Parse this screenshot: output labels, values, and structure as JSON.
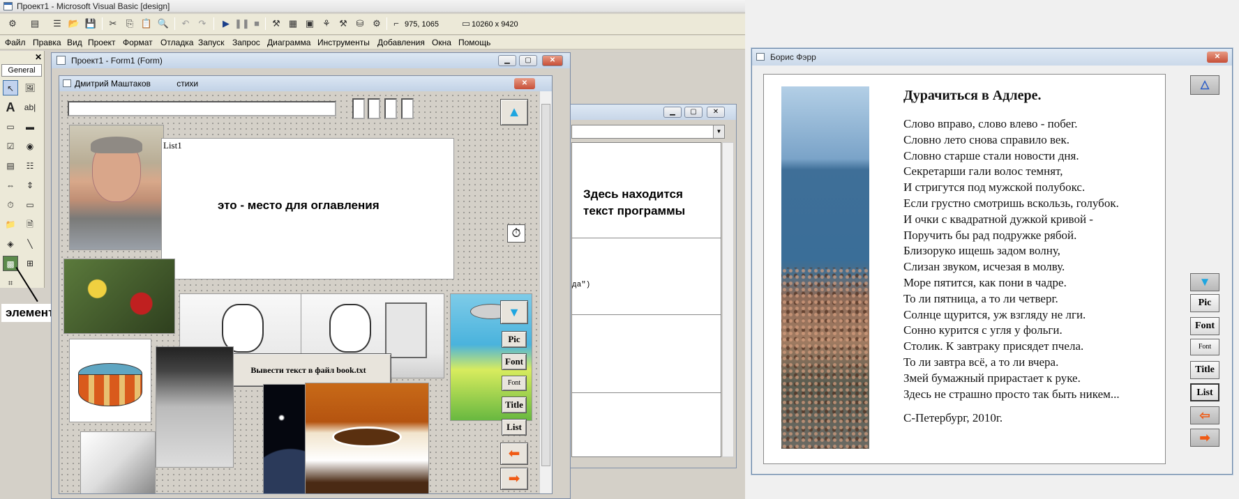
{
  "ide": {
    "title": "Проект1 - Microsoft Visual Basic [design]",
    "toolbar": {
      "coords": "975, 1065",
      "size": "10260 x 9420"
    },
    "menu": [
      "Файл",
      "Правка",
      "Вид",
      "Проект",
      "Формат",
      "Отладка",
      "Запуск",
      "Запрос",
      "Диаграмма",
      "Инструменты",
      "Добавления",
      "Окна",
      "Помощь"
    ],
    "toolbox": {
      "tab": "General",
      "close": "✕",
      "annotation": "элемент Image"
    },
    "form_window": {
      "title": "Проект1 - Form1 (Form)"
    },
    "code_window": {
      "note_line1": "Здесь находится",
      "note_line2": "текст программы",
      "snippet": "да\")"
    },
    "design_form": {
      "title": "Дмитрий Маштаков",
      "title_extra": "стихи",
      "list_label": "List1",
      "list_placeholder": "это - место для оглавления",
      "save_button": "Вывести текст в файл book.txt",
      "buttons": {
        "pic": "Pic",
        "font": "Font",
        "font_small": "Font",
        "title": "Title",
        "list": "List"
      }
    }
  },
  "running_form": {
    "title": "Борис Фэрр",
    "poem_title": "Дурачиться в Адлере.",
    "poem_lines": [
      "Слово вправо, слово влево - побег.",
      "Словно лето снова справило век.",
      "Словно старше стали новости дня.",
      "Секретарши гали волос темнят,",
      "И стригутся под мужской полубокс.",
      "Если грустно смотришь вскользь, голубок.",
      "И очки с квадратной дужкой кривой -",
      "Поручить бы рад подружке рябой.",
      "Близоруко ищешь задом волну,",
      "Слизан звуком, исчезая в молву.",
      "Море пятится, как пони в чадре.",
      "То ли пятница, а то ли четверг.",
      "Солнце щурится, уж взгляду не лги.",
      "Сонно курится с угля у фольги.",
      "Столик. К завтраку присядет пчела.",
      "То ли завтра всё, а то ли вчера.",
      "Змей бумажный прирастает к руке.",
      "Здесь не страшно просто так быть никем..."
    ],
    "poem_sign": "С-Петербург, 2010г.",
    "buttons": {
      "pic": "Pic",
      "font": "Font",
      "font_small": "Font",
      "title": "Title",
      "list": "List"
    }
  }
}
